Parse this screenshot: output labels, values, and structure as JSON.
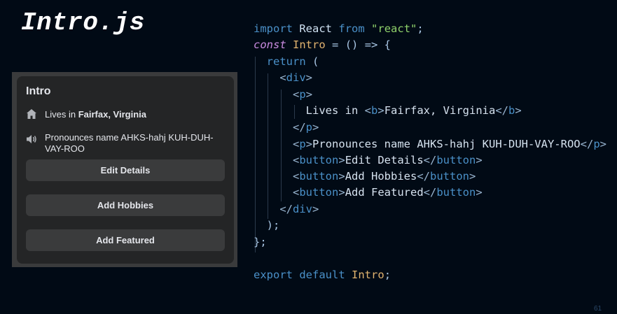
{
  "slide": {
    "title": "Intro.js",
    "page_number": "61"
  },
  "card": {
    "heading": "Intro",
    "lives_prefix": "Lives in ",
    "lives_place": "Fairfax, Virginia",
    "pronounce": "Pronounces name AHKS-hahj KUH-DUH-VAY-ROO",
    "buttons": {
      "edit": "Edit Details",
      "hobbies": "Add Hobbies",
      "featured": "Add Featured"
    }
  },
  "code": {
    "import_kw": "import",
    "react_name": "React",
    "from_kw": "from",
    "react_str": "\"react\"",
    "const_kw": "const",
    "component_name": "Intro",
    "return_kw": "return",
    "div": "div",
    "p": "p",
    "b": "b",
    "button": "button",
    "lives_text": "Lives in ",
    "place_text": "Fairfax, Virginia",
    "pron_text": "Pronounces name AHKS-hahj KUH-DUH-VAY-ROO",
    "edit_text": "Edit Details",
    "hobbies_text": "Add Hobbies",
    "featured_text": "Add Featured",
    "export_kw": "export",
    "default_kw": "default"
  },
  "colors": {
    "background": "#010a15",
    "card": "#242526",
    "button": "#3a3b3c"
  }
}
